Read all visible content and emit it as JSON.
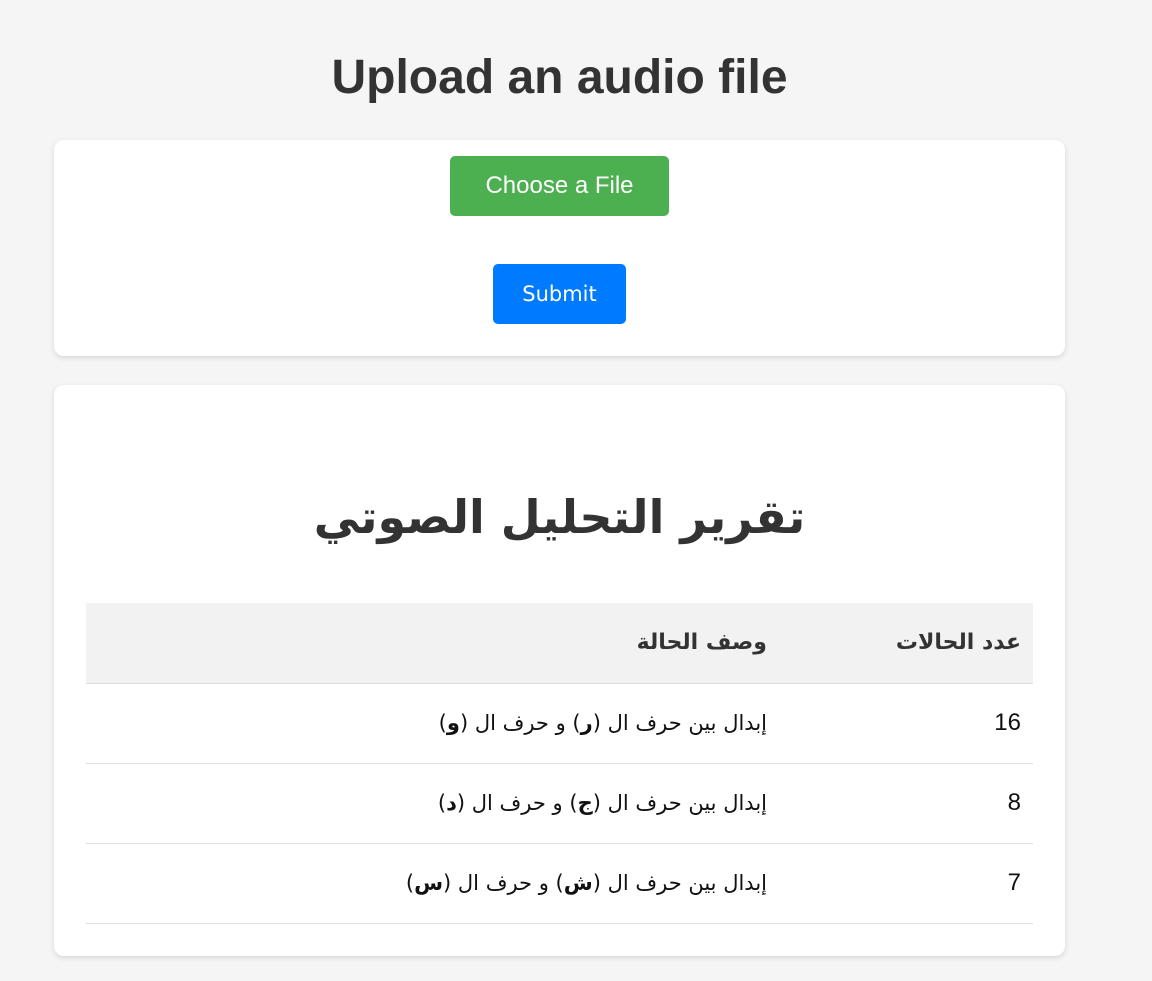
{
  "page": {
    "title": "Upload an audio file"
  },
  "upload": {
    "choose_label": "Choose a File",
    "submit_label": "Submit"
  },
  "report": {
    "title": "تقرير التحليل الصوتي",
    "columns": {
      "count": "عدد الحالات",
      "description": "وصف الحالة"
    },
    "rows": [
      {
        "count": "16",
        "prefix": "إبدال بين حرف ال",
        "letter1": "ر",
        "middle": "و حرف ال",
        "letter2": "و"
      },
      {
        "count": "8",
        "prefix": "إبدال بين حرف ال",
        "letter1": "ج",
        "middle": "و حرف ال",
        "letter2": "د"
      },
      {
        "count": "7",
        "prefix": "إبدال بين حرف ال",
        "letter1": "ش",
        "middle": "و حرف ال",
        "letter2": "س"
      }
    ]
  },
  "colors": {
    "background": "#f5f5f5",
    "choose_button": "#4caf50",
    "submit_button": "#007bff",
    "header_row": "#f2f2f2"
  }
}
